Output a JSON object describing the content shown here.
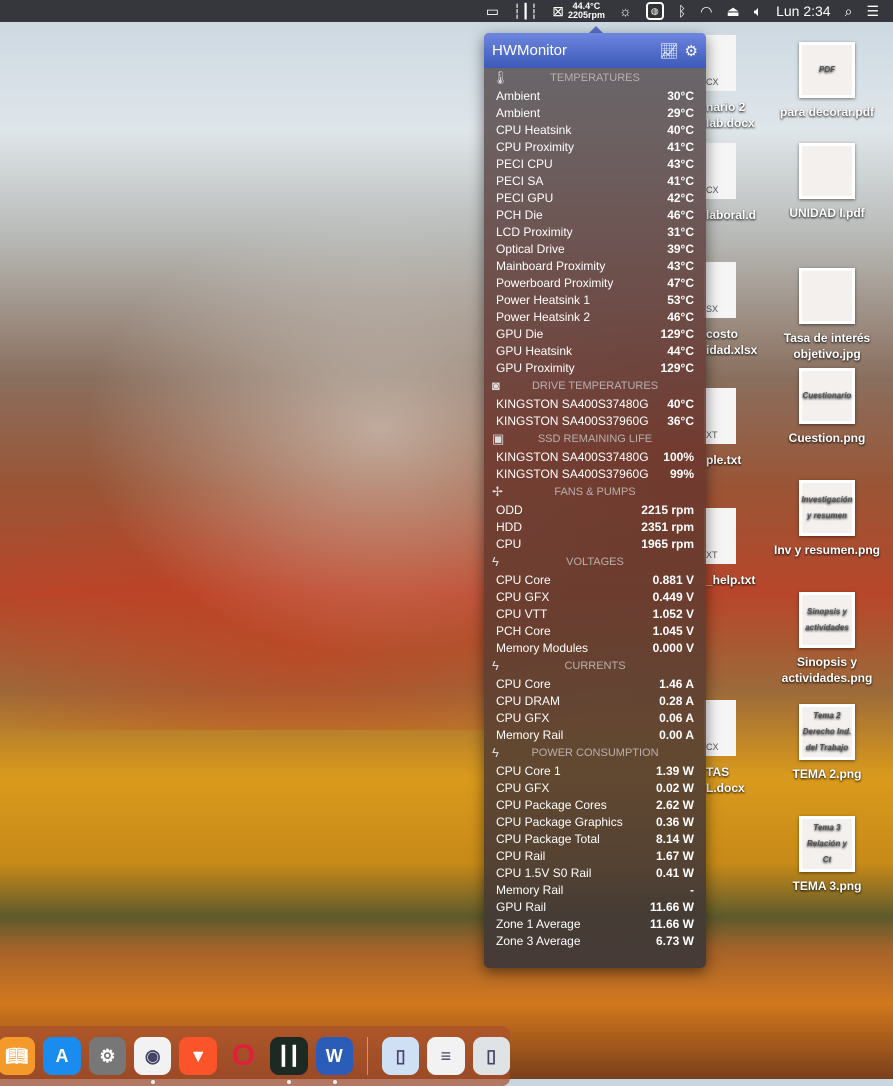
{
  "menubar": {
    "fan_temp": "44.4°C",
    "fan_rpm": "2205rpm",
    "clock": "Lun 2:34",
    "icons": [
      "display-icon",
      "audio-wave-icon",
      "fan-icon",
      "brightness-icon",
      "hwmonitor-icon",
      "bluetooth-icon",
      "wifi-icon",
      "eject-icon",
      "volume-icon",
      "search-icon",
      "list-icon"
    ]
  },
  "panel": {
    "title": "HWMonitor",
    "sections": [
      {
        "title": "TEMPERATURES",
        "icon": "thermometer-icon",
        "rows": [
          [
            "Ambient",
            "30°C"
          ],
          [
            "Ambient",
            "29°C"
          ],
          [
            "CPU Heatsink",
            "40°C"
          ],
          [
            "CPU Proximity",
            "41°C"
          ],
          [
            "PECI CPU",
            "43°C"
          ],
          [
            "PECI SA",
            "41°C"
          ],
          [
            "PECI GPU",
            "42°C"
          ],
          [
            "PCH Die",
            "46°C"
          ],
          [
            "LCD Proximity",
            "31°C"
          ],
          [
            "Optical Drive",
            "39°C"
          ],
          [
            "Mainboard Proximity",
            "43°C"
          ],
          [
            "Powerboard Proximity",
            "47°C"
          ],
          [
            "Power Heatsink 1",
            "53°C"
          ],
          [
            "Power Heatsink 2",
            "46°C"
          ],
          [
            "GPU Die",
            "129°C"
          ],
          [
            "GPU Heatsink",
            "44°C"
          ],
          [
            "GPU Proximity",
            "129°C"
          ]
        ]
      },
      {
        "title": "DRIVE TEMPERATURES",
        "icon": "drive-icon",
        "rows": [
          [
            "KINGSTON SA400S37480G",
            "40°C"
          ],
          [
            "KINGSTON SA400S37960G",
            "36°C"
          ]
        ]
      },
      {
        "title": "SSD REMAINING LIFE",
        "icon": "ssd-icon",
        "rows": [
          [
            "KINGSTON SA400S37480G",
            "100%"
          ],
          [
            "KINGSTON SA400S37960G",
            "99%"
          ]
        ]
      },
      {
        "title": "FANS & PUMPS",
        "icon": "fan-icon",
        "rows": [
          [
            "ODD",
            "2215 rpm"
          ],
          [
            "HDD",
            "2351 rpm"
          ],
          [
            "CPU",
            "1965 rpm"
          ]
        ]
      },
      {
        "title": "VOLTAGES",
        "icon": "lightning-icon",
        "rows": [
          [
            "CPU Core",
            "0.881 V"
          ],
          [
            "CPU GFX",
            "0.449 V"
          ],
          [
            "CPU VTT",
            "1.052 V"
          ],
          [
            "PCH Core",
            "1.045 V"
          ],
          [
            "Memory Modules",
            "0.000 V"
          ]
        ]
      },
      {
        "title": "CURRENTS",
        "icon": "lightning-icon",
        "rows": [
          [
            "CPU Core",
            "1.46 A"
          ],
          [
            "CPU DRAM",
            "0.28 A"
          ],
          [
            "CPU GFX",
            "0.06 A"
          ],
          [
            "Memory Rail",
            "0.00 A"
          ]
        ]
      },
      {
        "title": "POWER CONSUMPTION",
        "icon": "lightning-icon",
        "rows": [
          [
            "CPU Core 1",
            "1.39 W"
          ],
          [
            "CPU GFX",
            "0.02 W"
          ],
          [
            "CPU Package Cores",
            "2.62 W"
          ],
          [
            "CPU Package Graphics",
            "0.36 W"
          ],
          [
            "CPU Package Total",
            "8.14 W"
          ],
          [
            "CPU Rail",
            "1.67 W"
          ],
          [
            "CPU 1.5V S0 Rail",
            "0.41 W"
          ],
          [
            "Memory Rail",
            "-"
          ],
          [
            "GPU Rail",
            "11.66 W"
          ],
          [
            "Zone 1 Average",
            "11.66 W"
          ],
          [
            "Zone 3 Average",
            "6.73 W"
          ]
        ]
      }
    ]
  },
  "desktop": {
    "right": [
      {
        "label": "para decorar.pdf",
        "thumb": "PDF"
      },
      {
        "label": "UNIDAD I.pdf",
        "thumb": ""
      },
      {
        "label": "Tasa de interés objetivo.jpg",
        "thumb": ""
      },
      {
        "label": "Cuestion.png",
        "thumb": "Cuestionario"
      },
      {
        "label": "Inv y resumen.png",
        "thumb": "Investigación y resumen"
      },
      {
        "label": "Sinopsis y actividades.png",
        "thumb": "Sinopsis y actividades"
      },
      {
        "label": "TEMA 2.png",
        "thumb": "Tema 2 Derecho Ind. del Trabajo"
      },
      {
        "label": "TEMA 3.png",
        "thumb": "Tema 3 Relación y Ct"
      }
    ],
    "partial": [
      {
        "label": "nario 2 lab.docx",
        "ext": "CX"
      },
      {
        "label": "laboral.d",
        "ext": "CX"
      },
      {
        "label": "costo idad.xlsx",
        "ext": "SX"
      },
      {
        "label": "ple.txt",
        "ext": "XT"
      },
      {
        "label": "_help.txt",
        "ext": "XT"
      },
      {
        "label": "TAS L.docx",
        "ext": "CX"
      }
    ]
  },
  "dock": [
    {
      "name": "books",
      "color": "#f39a2b",
      "running": false
    },
    {
      "name": "app-store",
      "color": "#1a8cf0",
      "running": false
    },
    {
      "name": "system-preferences",
      "color": "#777",
      "running": false
    },
    {
      "name": "chrome",
      "color": "#f2f2f2",
      "running": true
    },
    {
      "name": "brave",
      "color": "#fb542b",
      "running": false
    },
    {
      "name": "opera",
      "color": "#d01a2f",
      "running": false
    },
    {
      "name": "audio-app",
      "color": "#1d2a24",
      "running": true
    },
    {
      "name": "word",
      "color": "#2b5cb8",
      "running": true
    },
    {
      "name": "zip-file",
      "color": "#cfe0f5",
      "running": false
    },
    {
      "name": "word-document",
      "color": "#f2f2f2",
      "running": false
    },
    {
      "name": "trash",
      "color": "#dfe3e6",
      "running": false
    }
  ]
}
